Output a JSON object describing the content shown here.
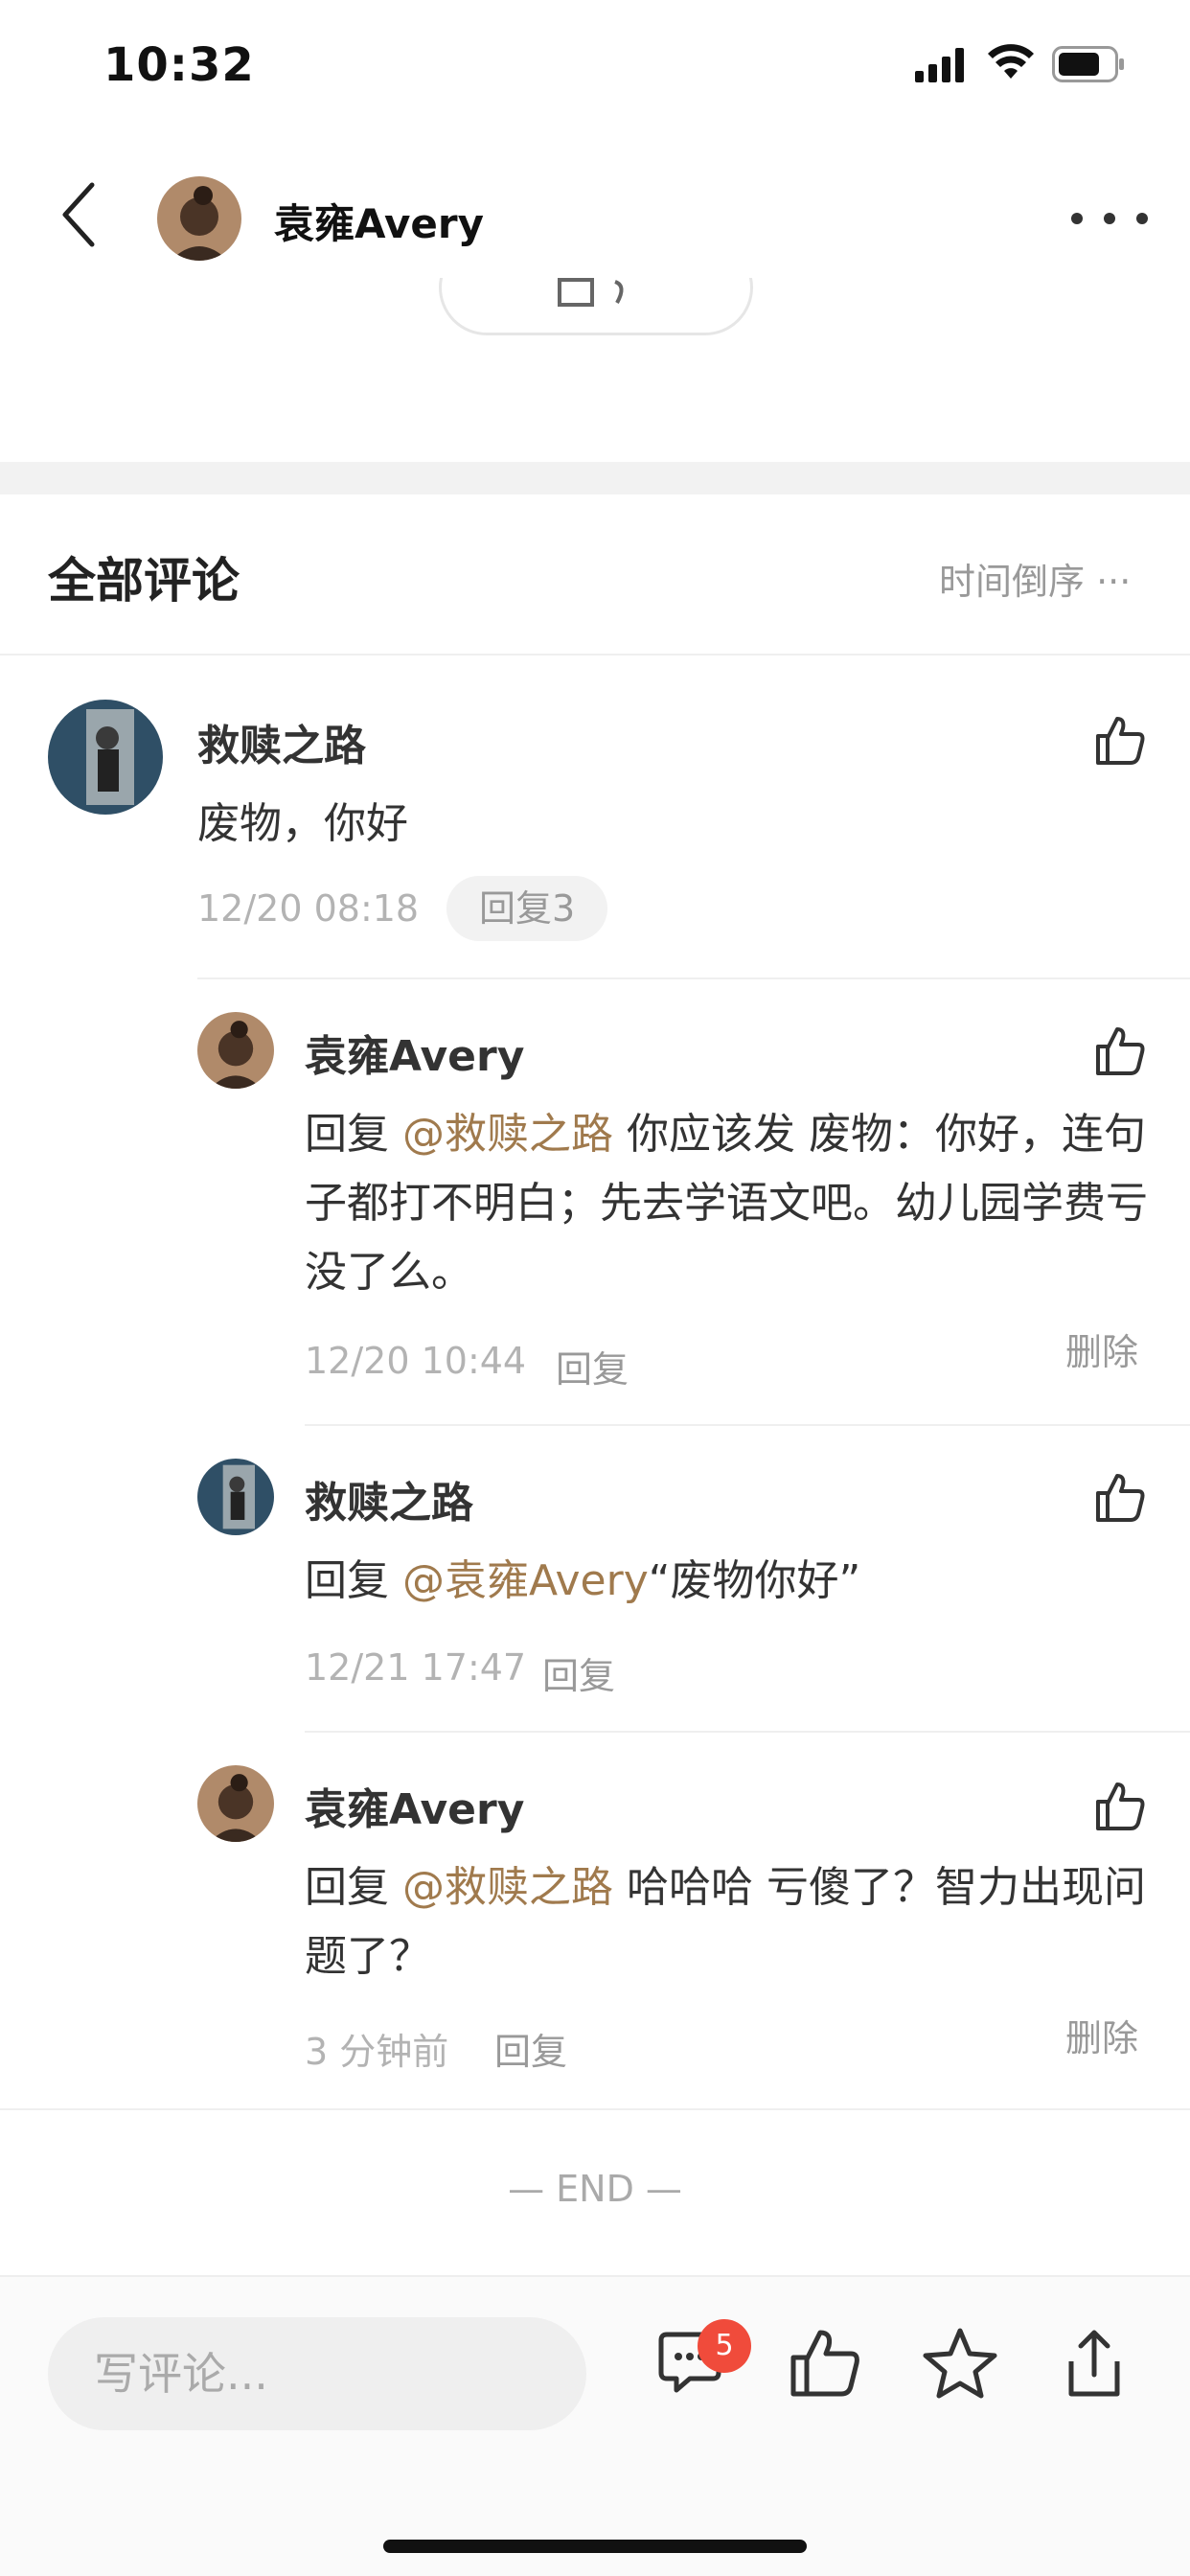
{
  "status_bar": {
    "time": "10:32"
  },
  "nav": {
    "title": "袁雍Avery"
  },
  "section": {
    "title": "全部评论",
    "sort_label": "时间倒序 ···"
  },
  "comments": [
    {
      "user": "救赎之路",
      "text": "废物，你好",
      "time": "12/20 08:18",
      "reply_label": "回复3"
    }
  ],
  "replies": [
    {
      "user": "袁雍Avery",
      "reply_prefix": "回复 ",
      "mention": "@救赎之路",
      "text": " 你应该发 废物：你好，连句子都打不明白；先去学语文吧。幼儿园学费亏没了么。",
      "time": "12/20 10:44",
      "reply_label": "回复",
      "delete_label": "删除"
    },
    {
      "user": "救赎之路",
      "reply_prefix": "回复 ",
      "mention": "@袁雍Avery",
      "text": "“废物你好”",
      "time": "12/21 17:47",
      "reply_label": "回复"
    },
    {
      "user": "袁雍Avery",
      "reply_prefix": "回复 ",
      "mention": "@救赎之路",
      "text": " 哈哈哈 亏傻了？智力出现问题了？",
      "time": "3 分钟前",
      "reply_label": "回复",
      "delete_label": "删除"
    }
  ],
  "end_label": "— END —",
  "bottom_bar": {
    "input_placeholder": "写评论...",
    "comment_count": "5"
  },
  "colors": {
    "mention": "#a07a4d",
    "badge": "#f04b3b",
    "muted": "#999999"
  },
  "icons": [
    "back-arrow-icon",
    "more-icon",
    "thumbs-up-icon",
    "comment-icon",
    "star-icon",
    "share-icon"
  ]
}
